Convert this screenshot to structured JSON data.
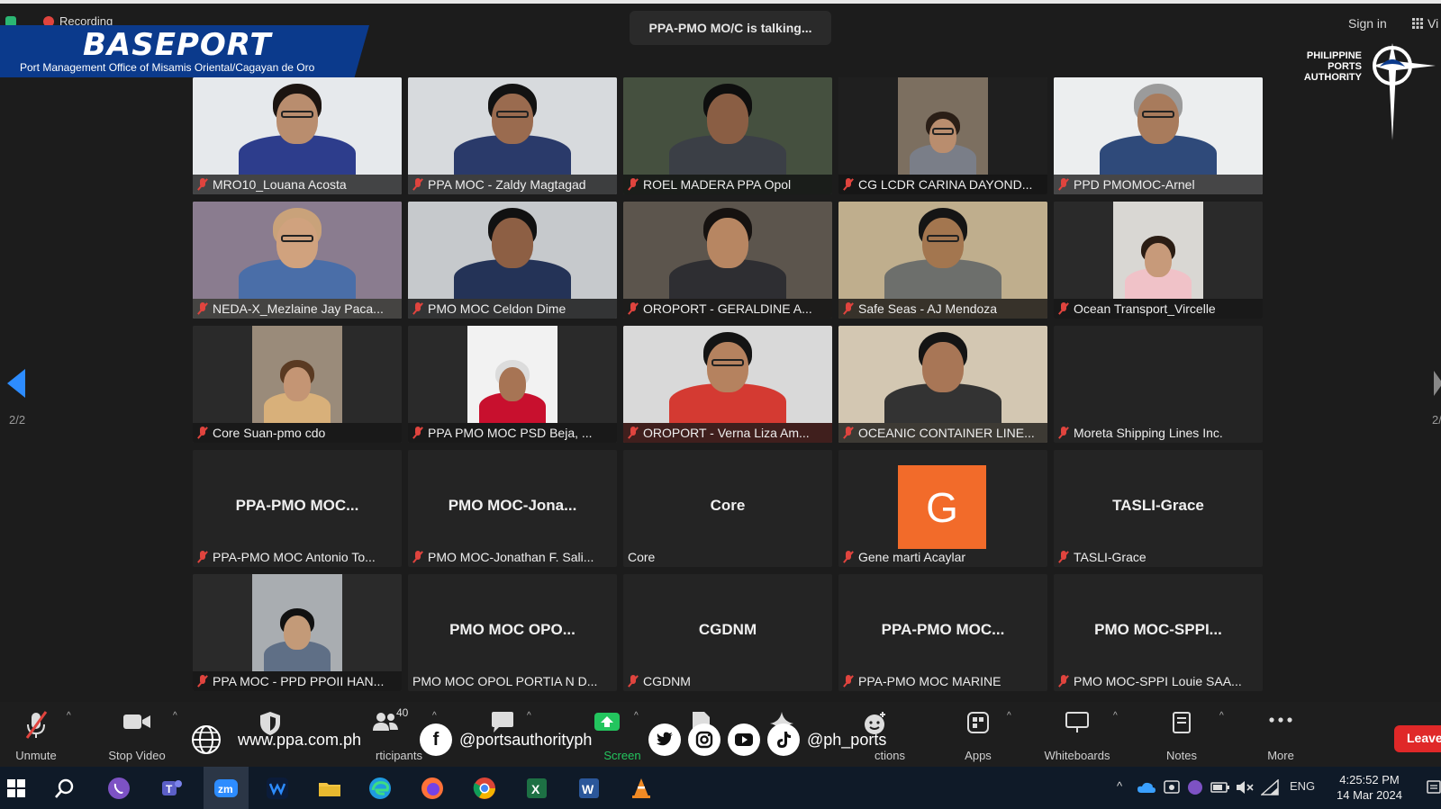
{
  "header": {
    "recording_label": "Recording",
    "banner_title": "BASEPORT",
    "banner_subtitle": "Port Management Office of Misamis Oriental/Cagayan de Oro",
    "talking": "PPA-PMO MO/C is talking...",
    "signin": "Sign in",
    "view_label": "Vi"
  },
  "logo": {
    "line1": "PHILIPPINE",
    "line2": "PORTS",
    "line3": "AUTHORITY"
  },
  "pagination": {
    "left": "2/2",
    "right": "2/",
    "accent": "#2d8cff"
  },
  "tiles": [
    {
      "name": "MRO10_Louana Acosta",
      "muted": true,
      "kind": "video"
    },
    {
      "name": "PPA MOC - Zaldy Magtagad",
      "muted": true,
      "kind": "video"
    },
    {
      "name": "ROEL MADERA PPA Opol",
      "muted": true,
      "kind": "video"
    },
    {
      "name": "CG LCDR CARINA DAYOND...",
      "muted": true,
      "kind": "video"
    },
    {
      "name": "PPD PMOMOC-Arnel",
      "muted": true,
      "kind": "video"
    },
    {
      "name": "NEDA-X_Mezlaine Jay Paca...",
      "muted": true,
      "kind": "video"
    },
    {
      "name": "PMO MOC Celdon Dime",
      "muted": true,
      "kind": "video"
    },
    {
      "name": "OROPORT - GERALDINE A...",
      "muted": true,
      "kind": "video"
    },
    {
      "name": "Safe Seas - AJ Mendoza",
      "muted": true,
      "kind": "video"
    },
    {
      "name": "Ocean Transport_Vircelle",
      "muted": true,
      "kind": "video"
    },
    {
      "name": "Core Suan-pmo cdo",
      "muted": true,
      "kind": "video"
    },
    {
      "name": "PPA PMO MOC PSD  Beja, ...",
      "muted": true,
      "kind": "video"
    },
    {
      "name": "OROPORT - Verna Liza Am...",
      "muted": true,
      "kind": "video"
    },
    {
      "name": "OCEANIC CONTAINER LINE...",
      "muted": true,
      "kind": "video"
    },
    {
      "name": "Moreta Shipping Lines Inc.",
      "muted": true,
      "kind": "blank"
    },
    {
      "name": "PPA-PMO MOC Antonio To...",
      "display": "PPA-PMO  MOC...",
      "muted": true,
      "kind": "text"
    },
    {
      "name": "PMO MOC-Jonathan F. Sali...",
      "display": "PMO  MOC-Jona...",
      "muted": true,
      "kind": "text"
    },
    {
      "name": "Core",
      "display": "Core",
      "muted": false,
      "kind": "text"
    },
    {
      "name": "Gene marti Acaylar",
      "avatar_letter": "G",
      "avatar_color": "#f26b2a",
      "muted": true,
      "kind": "avatar"
    },
    {
      "name": "TASLI-Grace",
      "display": "TASLI-Grace",
      "muted": true,
      "kind": "text"
    },
    {
      "name": "PPA MOC - PPD PPOII HAN...",
      "muted": true,
      "kind": "video"
    },
    {
      "name": "PMO MOC OPOL PORTIA N D...",
      "display": "PMO  MOC  OPO...",
      "muted": false,
      "kind": "text"
    },
    {
      "name": "CGDNM",
      "display": "CGDNM",
      "muted": true,
      "kind": "text"
    },
    {
      "name": "PPA-PMO MOC MARINE",
      "display": "PPA-PMO  MOC...",
      "muted": true,
      "kind": "text"
    },
    {
      "name": "PMO MOC-SPPI Louie SAA...",
      "display": "PMO  MOC-SPPI...",
      "muted": true,
      "kind": "text"
    }
  ],
  "toolbar": {
    "unmute": "Unmute",
    "stop_video": "Stop Video",
    "participants": "Participants",
    "participants_short": "rticipants",
    "participants_count": "40",
    "share_screen_short": "Screen",
    "reactions_short": "ctions",
    "apps": "Apps",
    "whiteboards": "Whiteboards",
    "notes": "Notes",
    "more": "More",
    "leave": "Leave"
  },
  "social": {
    "website": "www.ppa.com.ph",
    "facebook": "@portsauthorityph",
    "handle": "@ph_ports"
  },
  "taskbar": {
    "language": "ENG",
    "time": "4:25:52 PM",
    "date": "14 Mar 2024"
  }
}
